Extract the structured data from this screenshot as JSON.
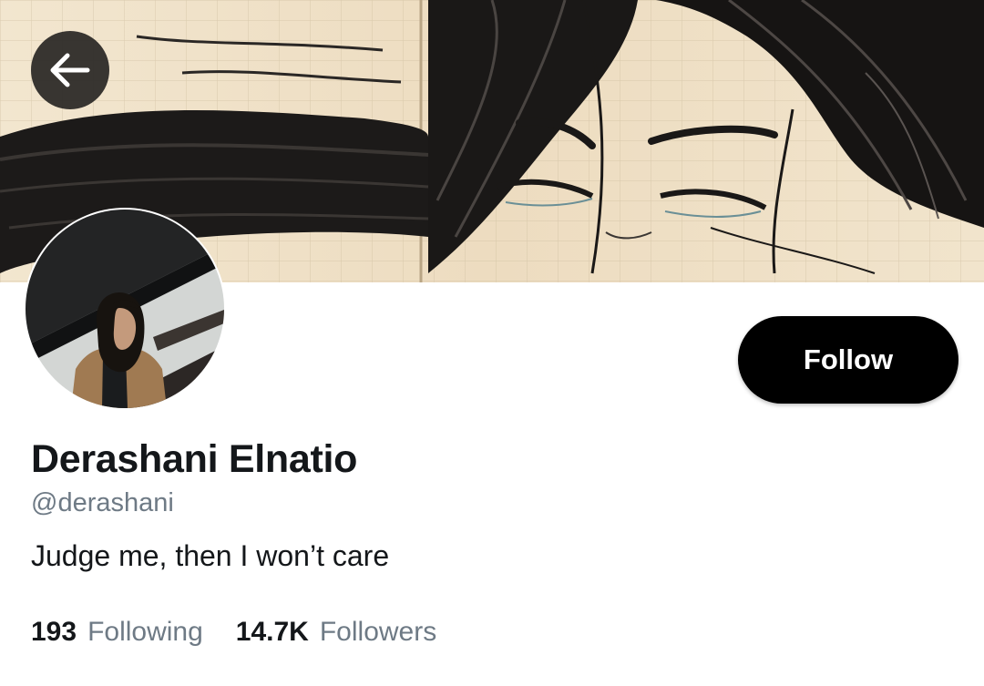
{
  "profile": {
    "name": "Derashani Elnatio",
    "handle": "@derashani",
    "bio": "Judge me, then I won’t care"
  },
  "actions": {
    "follow_label": "Follow",
    "back_icon": "arrow-left-icon"
  },
  "stats": {
    "following_count": "193",
    "following_label": "Following",
    "followers_count": "14.7K",
    "followers_label": "Followers"
  },
  "colors": {
    "follow_button_bg": "#000000",
    "follow_button_text": "#ffffff",
    "secondary_text": "#6e7a85",
    "primary_text": "#14171a"
  }
}
